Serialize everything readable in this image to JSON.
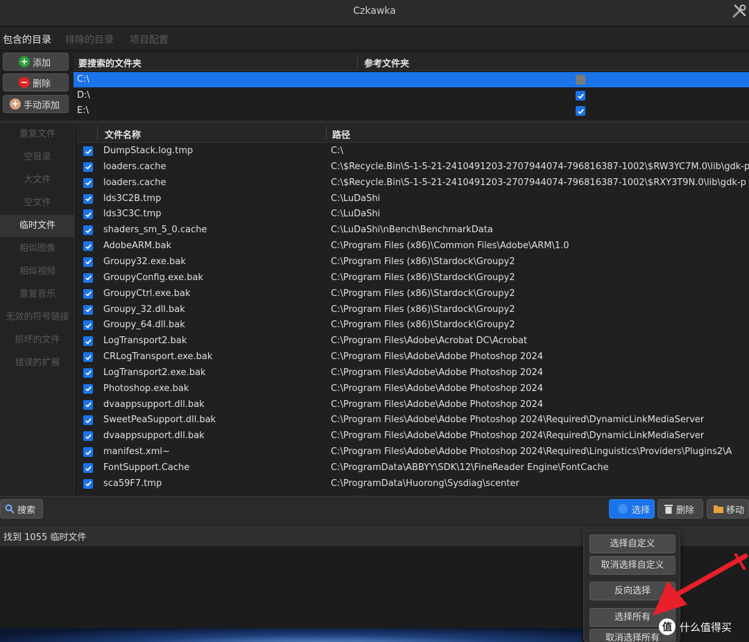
{
  "window": {
    "title": "Czkawka"
  },
  "tabs": [
    {
      "label": "包含的目录",
      "active": true
    },
    {
      "label": "排除的目录",
      "active": false
    },
    {
      "label": "项目配置",
      "active": false
    }
  ],
  "dir_buttons": {
    "add": "添加",
    "remove": "删除",
    "manual_add": "手动添加"
  },
  "dir_table": {
    "col_folder": "要搜索的文件夹",
    "col_reference": "参考文件夹",
    "rows": [
      {
        "path": "C:\\",
        "reference": false,
        "selected": true
      },
      {
        "path": "D:\\",
        "reference": true,
        "selected": false
      },
      {
        "path": "E:\\",
        "reference": true,
        "selected": false
      }
    ]
  },
  "sidebar": {
    "items": [
      {
        "label": "重复文件",
        "active": false
      },
      {
        "label": "空目录",
        "active": false
      },
      {
        "label": "大文件",
        "active": false
      },
      {
        "label": "空文件",
        "active": false
      },
      {
        "label": "临时文件",
        "active": true
      },
      {
        "label": "相似图像",
        "active": false
      },
      {
        "label": "相似视频",
        "active": false
      },
      {
        "label": "重复音乐",
        "active": false
      },
      {
        "label": "无效的符号链接",
        "active": false
      },
      {
        "label": "损坏的文件",
        "active": false
      },
      {
        "label": "错误的扩展",
        "active": false
      }
    ]
  },
  "file_table": {
    "col_name": "文件名称",
    "col_path": "路径",
    "rows": [
      {
        "name": "DumpStack.log.tmp",
        "path": "C:\\"
      },
      {
        "name": "loaders.cache",
        "path": "C:\\$Recycle.Bin\\S-1-5-21-2410491203-2707944074-796816387-1002\\$RW3YC7M.0\\lib\\gdk-p"
      },
      {
        "name": "loaders.cache",
        "path": "C:\\$Recycle.Bin\\S-1-5-21-2410491203-2707944074-796816387-1002\\$RXY3T9N.0\\lib\\gdk-p"
      },
      {
        "name": "lds3C2B.tmp",
        "path": "C:\\LuDaShi"
      },
      {
        "name": "lds3C3C.tmp",
        "path": "C:\\LuDaShi"
      },
      {
        "name": "shaders_sm_5_0.cache",
        "path": "C:\\LuDaShi\\nBench\\BenchmarkData"
      },
      {
        "name": "AdobeARM.bak",
        "path": "C:\\Program Files (x86)\\Common Files\\Adobe\\ARM\\1.0"
      },
      {
        "name": "Groupy32.exe.bak",
        "path": "C:\\Program Files (x86)\\Stardock\\Groupy2"
      },
      {
        "name": "GroupyConfig.exe.bak",
        "path": "C:\\Program Files (x86)\\Stardock\\Groupy2"
      },
      {
        "name": "GroupyCtrl.exe.bak",
        "path": "C:\\Program Files (x86)\\Stardock\\Groupy2"
      },
      {
        "name": "Groupy_32.dll.bak",
        "path": "C:\\Program Files (x86)\\Stardock\\Groupy2"
      },
      {
        "name": "Groupy_64.dll.bak",
        "path": "C:\\Program Files (x86)\\Stardock\\Groupy2"
      },
      {
        "name": "LogTransport2.bak",
        "path": "C:\\Program Files\\Adobe\\Acrobat DC\\Acrobat"
      },
      {
        "name": "CRLogTransport.exe.bak",
        "path": "C:\\Program Files\\Adobe\\Adobe Photoshop 2024"
      },
      {
        "name": "LogTransport2.exe.bak",
        "path": "C:\\Program Files\\Adobe\\Adobe Photoshop 2024"
      },
      {
        "name": "Photoshop.exe.bak",
        "path": "C:\\Program Files\\Adobe\\Adobe Photoshop 2024"
      },
      {
        "name": "dvaappsupport.dll.bak",
        "path": "C:\\Program Files\\Adobe\\Adobe Photoshop 2024"
      },
      {
        "name": "SweetPeaSupport.dll.bak",
        "path": "C:\\Program Files\\Adobe\\Adobe Photoshop 2024\\Required\\DynamicLinkMediaServer"
      },
      {
        "name": "dvaappsupport.dll.bak",
        "path": "C:\\Program Files\\Adobe\\Adobe Photoshop 2024\\Required\\DynamicLinkMediaServer"
      },
      {
        "name": "manifest.xml~",
        "path": "C:\\Program Files\\Adobe\\Adobe Photoshop 2024\\Required\\Linguistics\\Providers\\Plugins2\\A"
      },
      {
        "name": "FontSupport.Cache",
        "path": "C:\\ProgramData\\ABBYY\\SDK\\12\\FineReader Engine\\FontCache"
      },
      {
        "name": "sca59F7.tmp",
        "path": "C:\\ProgramData\\Huorong\\Sysdiag\\scenter"
      }
    ]
  },
  "bottom_buttons": {
    "search": "搜索",
    "select": "选择",
    "delete": "删除",
    "move": "移动"
  },
  "status": {
    "text": "找到 1055 临时文件"
  },
  "select_popup": {
    "items": [
      "选择自定义",
      "取消选择自定义",
      "反向选择",
      "选择所有",
      "取消选择所有"
    ]
  },
  "watermark": {
    "text": "什么值得买",
    "icon": "值"
  },
  "colors": {
    "accent": "#1a73e8",
    "add_icon": "#2e9e3a",
    "remove_icon": "#e02424",
    "arrow": "#e8202a"
  }
}
